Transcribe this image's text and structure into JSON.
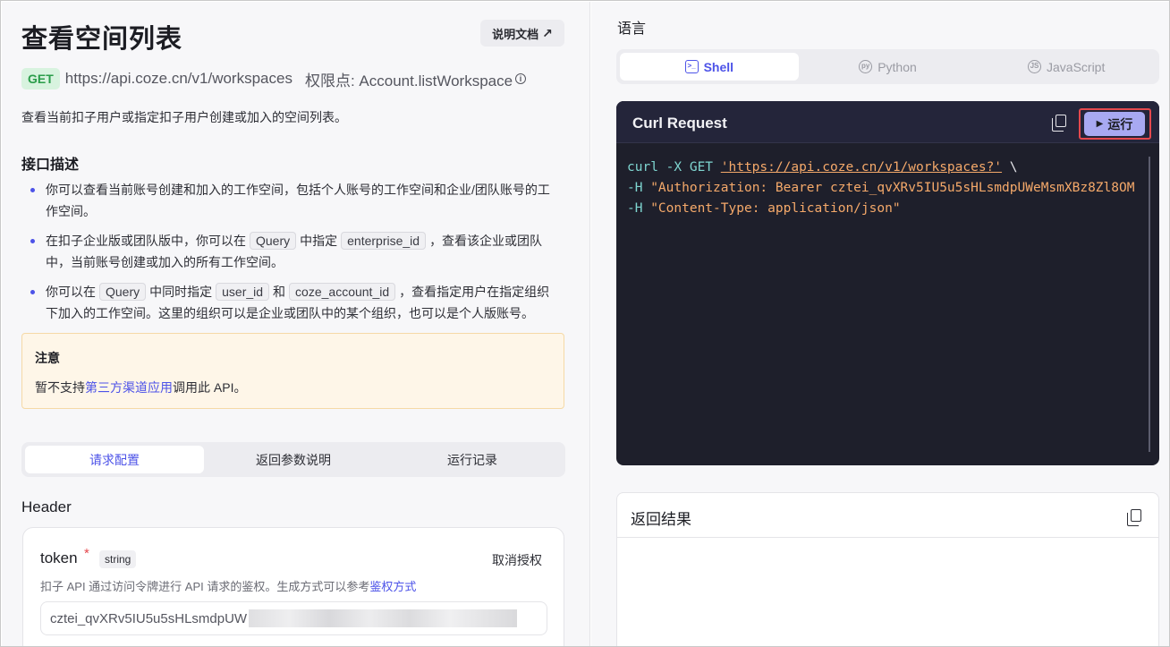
{
  "left": {
    "title": "查看空间列表",
    "doc_button": "说明文档",
    "doc_button_icon": "external-arrow-icon",
    "method": "GET",
    "endpoint": "https://api.coze.cn/v1/workspaces",
    "permission": "权限点: Account.listWorkspace",
    "description": "查看当前扣子用户或指定扣子用户创建或加入的空间列表。",
    "section_title": "接口描述",
    "bullets": [
      {
        "text": "你可以查看当前账号创建和加入的工作空间，包括个人账号的工作空间和企业/团队账号的工作空间。"
      },
      {
        "pre": "在扣子企业版或团队版中，你可以在",
        "code1": "Query",
        "mid": "中指定",
        "code2": "enterprise_id",
        "post": "，查看该企业或团队中，当前账号创建或加入的所有工作空间。"
      },
      {
        "pre": "你可以在",
        "code1": "Query",
        "mid1": "中同时指定",
        "code2": "user_id",
        "mid2": "和",
        "code3": "coze_account_id",
        "post": "，查看指定用户在指定组织下加入的工作空间。这里的组织可以是企业或团队中的某个组织，也可以是个人版账号。"
      }
    ],
    "notice": {
      "title": "注意",
      "pre": "暂不支持",
      "link": "第三方渠道应用",
      "post": "调用此 API。"
    },
    "tabs": [
      "请求配置",
      "返回参数说明",
      "运行记录"
    ],
    "active_tab": 0,
    "header_title": "Header",
    "token": {
      "label": "token",
      "required": "*",
      "type": "string",
      "revoke": "取消授权",
      "hint": "扣子 API 通过访问令牌进行 API 请求的鉴权。生成方式可以参考",
      "hint_link": "鉴权方式",
      "value": "cztei_qvXRv5IU5u5sHLsmdpUW"
    }
  },
  "right": {
    "lang_label": "语言",
    "lang_tabs": [
      {
        "label": "Shell",
        "icon": "terminal-icon"
      },
      {
        "label": "Python",
        "icon": "python-icon"
      },
      {
        "label": "JavaScript",
        "icon": "javascript-icon"
      }
    ],
    "active_lang": 0,
    "code_title": "Curl Request",
    "run_label": "运行",
    "code_lines": {
      "l1_cmd": "curl -X GET ",
      "l1_url": "'https://api.coze.cn/v1/workspaces?'",
      "l1_tail": " \\",
      "l2_flag": "-H ",
      "l2_str": "\"Authorization: Bearer cztei_qvXRv5IU5u5sHLsmdpUWeMsmXBz8Zl8OM",
      "l3_flag": "-H ",
      "l3_str": "\"Content-Type: application/json\""
    },
    "result_title": "返回结果"
  },
  "colors": {
    "accent": "#4d53e8",
    "get_badge": "#2a9d4a",
    "run_button": "#a8a9f2",
    "highlight": "#e5484d",
    "code_bg": "#1e1f2b"
  }
}
